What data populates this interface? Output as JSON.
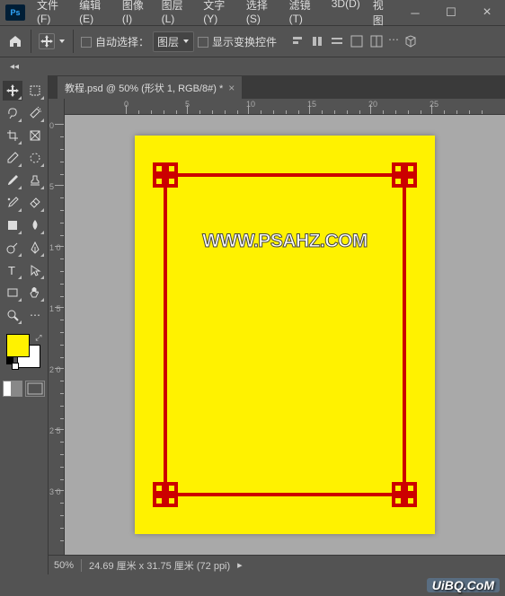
{
  "menu": [
    "文件(F)",
    "编辑(E)",
    "图像(I)",
    "图层(L)",
    "文字(Y)",
    "选择(S)",
    "滤镜(T)",
    "3D(D)",
    "视图"
  ],
  "options": {
    "auto_select": "自动选择：",
    "select_target": "图层",
    "show_transform": "显示变换控件"
  },
  "tab": {
    "title": "教程.psd @ 50% (形状 1, RGB/8#) *"
  },
  "ruler_h": [
    "0",
    "5",
    "10",
    "15",
    "20",
    "25"
  ],
  "ruler_v": [
    "0",
    "5",
    "1\n0",
    "1\n5",
    "2\n0",
    "2\n5",
    "3\n0"
  ],
  "canvas": {
    "text": "WWW.PSAHZ.COM",
    "bg": "#fff200",
    "border": "#cc0000"
  },
  "swatches": {
    "fg": "#fff200",
    "bg": "#ffffff"
  },
  "status": {
    "zoom": "50%",
    "info": "24.69 厘米 x 31.75 厘米 (72 ppi)"
  },
  "watermark": "UiBQ.CoM"
}
